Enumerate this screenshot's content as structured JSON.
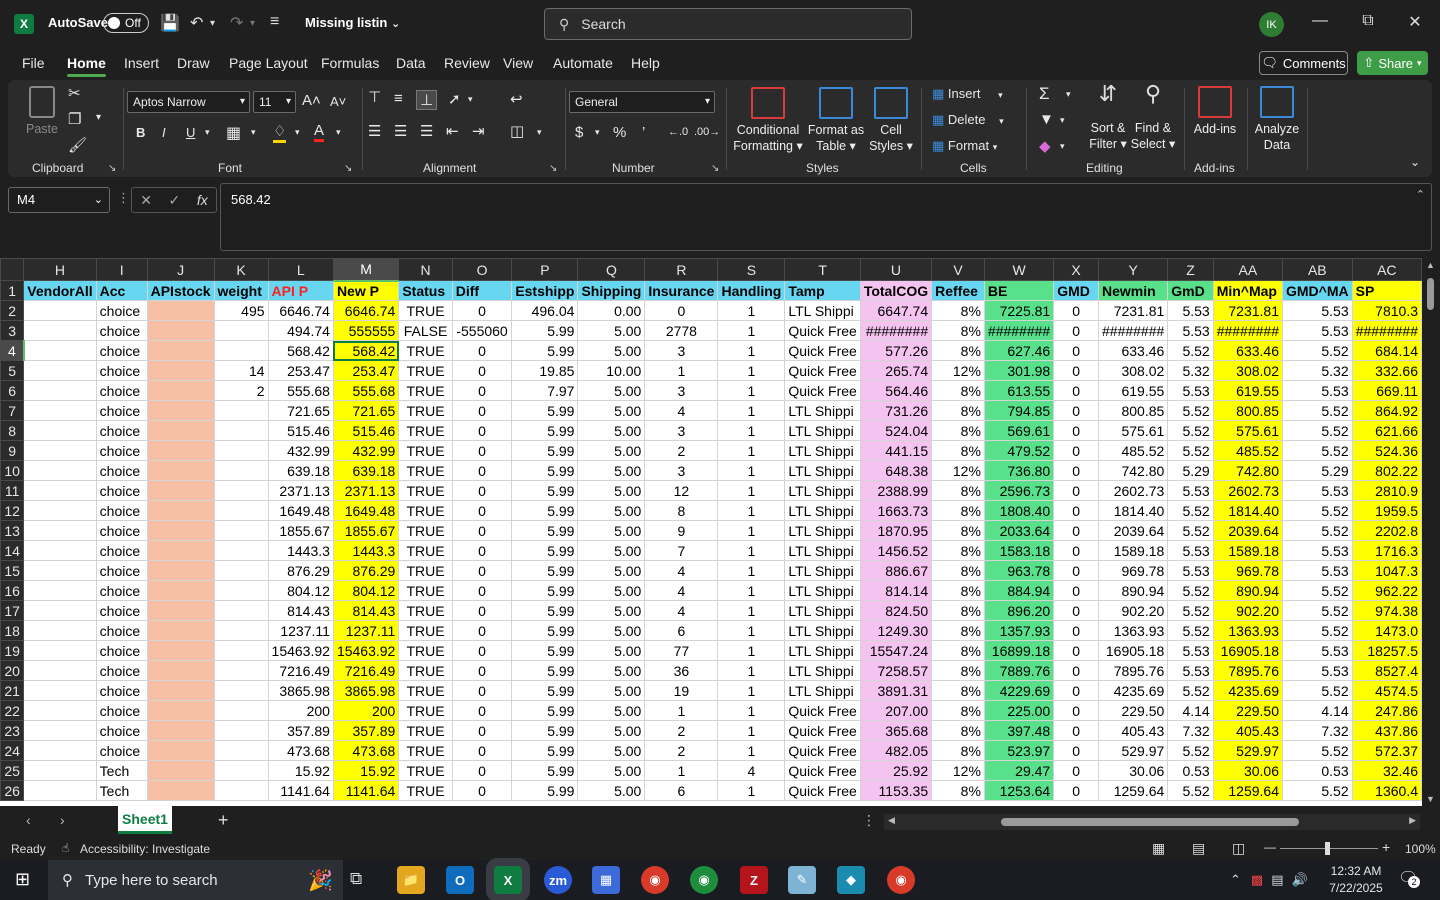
{
  "titlebar": {
    "app_icon": "excel-logo",
    "autosave_label": "AutoSave",
    "autosave_state": "Off",
    "doc_title": "Missing listin",
    "search_placeholder": "Search",
    "avatar_initials": "IK"
  },
  "menu": {
    "tabs": [
      "File",
      "Home",
      "Insert",
      "Draw",
      "Page Layout",
      "Formulas",
      "Data",
      "Review",
      "View",
      "Automate",
      "Help"
    ],
    "active": "Home",
    "comments_label": "Comments",
    "share_label": "Share"
  },
  "ribbon": {
    "clipboard": {
      "label": "Clipboard",
      "paste": "Paste"
    },
    "font": {
      "label": "Font",
      "family": "Aptos Narrow",
      "size": "11"
    },
    "alignment": {
      "label": "Alignment"
    },
    "number": {
      "label": "Number",
      "format": "General"
    },
    "styles": {
      "label": "Styles",
      "conditional_1": "Conditional",
      "conditional_2": "Formatting",
      "format_table_1": "Format as",
      "format_table_2": "Table",
      "cell_styles_1": "Cell",
      "cell_styles_2": "Styles"
    },
    "cells": {
      "label": "Cells",
      "insert": "Insert",
      "delete": "Delete",
      "format": "Format"
    },
    "editing": {
      "label": "Editing",
      "sort_1": "Sort &",
      "sort_2": "Filter",
      "find_1": "Find &",
      "find_2": "Select"
    },
    "addins": {
      "label": "Add-ins",
      "addins": "Add-ins",
      "analyze_1": "Analyze",
      "analyze_2": "Data"
    }
  },
  "formula_bar": {
    "name_box": "M4",
    "formula": "568.42"
  },
  "grid": {
    "columns": [
      "H",
      "I",
      "J",
      "K",
      "L",
      "M",
      "N",
      "O",
      "P",
      "Q",
      "R",
      "S",
      "T",
      "U",
      "V",
      "W",
      "X",
      "Y",
      "Z",
      "AA",
      "AB",
      "AC"
    ],
    "selected_column": "M",
    "selected_row": "4",
    "header_row": [
      "VendorAll",
      "Acc",
      "APIstock",
      "weight",
      "API P",
      "New P",
      "Status",
      "Diff",
      "Estshipp",
      "Shipping",
      "Insurance",
      "Handling",
      "Tamp",
      "TotalCOG",
      "Reffee",
      "BE",
      "GMD",
      "Newmin",
      "GmD",
      "Min^Map",
      "GMD^MA",
      "SP"
    ],
    "rows": [
      [
        "2",
        "",
        "choice",
        "",
        "495",
        "6646.74",
        "6646.74",
        "TRUE",
        "0",
        "496.04",
        "0.00",
        "0",
        "1",
        "LTL Shippi",
        "6647.74",
        "8%",
        "7225.81",
        "0",
        "7231.81",
        "5.53",
        "7231.81",
        "5.53",
        "7810.3"
      ],
      [
        "3",
        "",
        "choice",
        "",
        "",
        "494.74",
        "555555",
        "FALSE",
        "-555060",
        "5.99",
        "5.00",
        "2778",
        "1",
        "Quick Free",
        "########",
        "8%",
        "########",
        "0",
        "########",
        "5.53",
        "########",
        "5.53",
        "########"
      ],
      [
        "4",
        "",
        "choice",
        "",
        "",
        "568.42",
        "568.42",
        "TRUE",
        "0",
        "5.99",
        "5.00",
        "3",
        "1",
        "Quick Free",
        "577.26",
        "8%",
        "627.46",
        "0",
        "633.46",
        "5.52",
        "633.46",
        "5.52",
        "684.14"
      ],
      [
        "5",
        "",
        "choice",
        "",
        "14",
        "253.47",
        "253.47",
        "TRUE",
        "0",
        "19.85",
        "10.00",
        "1",
        "1",
        "Quick Free",
        "265.74",
        "12%",
        "301.98",
        "0",
        "308.02",
        "5.32",
        "308.02",
        "5.32",
        "332.66"
      ],
      [
        "6",
        "",
        "choice",
        "",
        "2",
        "555.68",
        "555.68",
        "TRUE",
        "0",
        "7.97",
        "5.00",
        "3",
        "1",
        "Quick Free",
        "564.46",
        "8%",
        "613.55",
        "0",
        "619.55",
        "5.53",
        "619.55",
        "5.53",
        "669.11"
      ],
      [
        "7",
        "",
        "choice",
        "",
        "",
        "721.65",
        "721.65",
        "TRUE",
        "0",
        "5.99",
        "5.00",
        "4",
        "1",
        "LTL Shippi",
        "731.26",
        "8%",
        "794.85",
        "0",
        "800.85",
        "5.52",
        "800.85",
        "5.52",
        "864.92"
      ],
      [
        "8",
        "",
        "choice",
        "",
        "",
        "515.46",
        "515.46",
        "TRUE",
        "0",
        "5.99",
        "5.00",
        "3",
        "1",
        "LTL Shippi",
        "524.04",
        "8%",
        "569.61",
        "0",
        "575.61",
        "5.52",
        "575.61",
        "5.52",
        "621.66"
      ],
      [
        "9",
        "",
        "choice",
        "",
        "",
        "432.99",
        "432.99",
        "TRUE",
        "0",
        "5.99",
        "5.00",
        "2",
        "1",
        "LTL Shippi",
        "441.15",
        "8%",
        "479.52",
        "0",
        "485.52",
        "5.52",
        "485.52",
        "5.52",
        "524.36"
      ],
      [
        "10",
        "",
        "choice",
        "",
        "",
        "639.18",
        "639.18",
        "TRUE",
        "0",
        "5.99",
        "5.00",
        "3",
        "1",
        "LTL Shippi",
        "648.38",
        "12%",
        "736.80",
        "0",
        "742.80",
        "5.29",
        "742.80",
        "5.29",
        "802.22"
      ],
      [
        "11",
        "",
        "choice",
        "",
        "",
        "2371.13",
        "2371.13",
        "TRUE",
        "0",
        "5.99",
        "5.00",
        "12",
        "1",
        "LTL Shippi",
        "2388.99",
        "8%",
        "2596.73",
        "0",
        "2602.73",
        "5.53",
        "2602.73",
        "5.53",
        "2810.9"
      ],
      [
        "12",
        "",
        "choice",
        "",
        "",
        "1649.48",
        "1649.48",
        "TRUE",
        "0",
        "5.99",
        "5.00",
        "8",
        "1",
        "LTL Shippi",
        "1663.73",
        "8%",
        "1808.40",
        "0",
        "1814.40",
        "5.52",
        "1814.40",
        "5.52",
        "1959.5"
      ],
      [
        "13",
        "",
        "choice",
        "",
        "",
        "1855.67",
        "1855.67",
        "TRUE",
        "0",
        "5.99",
        "5.00",
        "9",
        "1",
        "LTL Shippi",
        "1870.95",
        "8%",
        "2033.64",
        "0",
        "2039.64",
        "5.52",
        "2039.64",
        "5.52",
        "2202.8"
      ],
      [
        "14",
        "",
        "choice",
        "",
        "",
        "1443.3",
        "1443.3",
        "TRUE",
        "0",
        "5.99",
        "5.00",
        "7",
        "1",
        "LTL Shippi",
        "1456.52",
        "8%",
        "1583.18",
        "0",
        "1589.18",
        "5.53",
        "1589.18",
        "5.53",
        "1716.3"
      ],
      [
        "15",
        "",
        "choice",
        "",
        "",
        "876.29",
        "876.29",
        "TRUE",
        "0",
        "5.99",
        "5.00",
        "4",
        "1",
        "LTL Shippi",
        "886.67",
        "8%",
        "963.78",
        "0",
        "969.78",
        "5.53",
        "969.78",
        "5.53",
        "1047.3"
      ],
      [
        "16",
        "",
        "choice",
        "",
        "",
        "804.12",
        "804.12",
        "TRUE",
        "0",
        "5.99",
        "5.00",
        "4",
        "1",
        "LTL Shippi",
        "814.14",
        "8%",
        "884.94",
        "0",
        "890.94",
        "5.52",
        "890.94",
        "5.52",
        "962.22"
      ],
      [
        "17",
        "",
        "choice",
        "",
        "",
        "814.43",
        "814.43",
        "TRUE",
        "0",
        "5.99",
        "5.00",
        "4",
        "1",
        "LTL Shippi",
        "824.50",
        "8%",
        "896.20",
        "0",
        "902.20",
        "5.52",
        "902.20",
        "5.52",
        "974.38"
      ],
      [
        "18",
        "",
        "choice",
        "",
        "",
        "1237.11",
        "1237.11",
        "TRUE",
        "0",
        "5.99",
        "5.00",
        "6",
        "1",
        "LTL Shippi",
        "1249.30",
        "8%",
        "1357.93",
        "0",
        "1363.93",
        "5.52",
        "1363.93",
        "5.52",
        "1473.0"
      ],
      [
        "19",
        "",
        "choice",
        "",
        "",
        "15463.92",
        "15463.92",
        "TRUE",
        "0",
        "5.99",
        "5.00",
        "77",
        "1",
        "LTL Shippi",
        "15547.24",
        "8%",
        "16899.18",
        "0",
        "16905.18",
        "5.53",
        "16905.18",
        "5.53",
        "18257.5"
      ],
      [
        "20",
        "",
        "choice",
        "",
        "",
        "7216.49",
        "7216.49",
        "TRUE",
        "0",
        "5.99",
        "5.00",
        "36",
        "1",
        "LTL Shippi",
        "7258.57",
        "8%",
        "7889.76",
        "0",
        "7895.76",
        "5.53",
        "7895.76",
        "5.53",
        "8527.4"
      ],
      [
        "21",
        "",
        "choice",
        "",
        "",
        "3865.98",
        "3865.98",
        "TRUE",
        "0",
        "5.99",
        "5.00",
        "19",
        "1",
        "LTL Shippi",
        "3891.31",
        "8%",
        "4229.69",
        "0",
        "4235.69",
        "5.52",
        "4235.69",
        "5.52",
        "4574.5"
      ],
      [
        "22",
        "",
        "choice",
        "",
        "",
        "200",
        "200",
        "TRUE",
        "0",
        "5.99",
        "5.00",
        "1",
        "1",
        "Quick Free",
        "207.00",
        "8%",
        "225.00",
        "0",
        "229.50",
        "4.14",
        "229.50",
        "4.14",
        "247.86"
      ],
      [
        "23",
        "",
        "choice",
        "",
        "",
        "357.89",
        "357.89",
        "TRUE",
        "0",
        "5.99",
        "5.00",
        "2",
        "1",
        "Quick Free",
        "365.68",
        "8%",
        "397.48",
        "0",
        "405.43",
        "7.32",
        "405.43",
        "7.32",
        "437.86"
      ],
      [
        "24",
        "",
        "choice",
        "",
        "",
        "473.68",
        "473.68",
        "TRUE",
        "0",
        "5.99",
        "5.00",
        "2",
        "1",
        "Quick Free",
        "482.05",
        "8%",
        "523.97",
        "0",
        "529.97",
        "5.52",
        "529.97",
        "5.52",
        "572.37"
      ],
      [
        "25",
        "",
        "Tech",
        "",
        "",
        "15.92",
        "15.92",
        "TRUE",
        "0",
        "5.99",
        "5.00",
        "1",
        "4",
        "Quick Free",
        "25.92",
        "12%",
        "29.47",
        "0",
        "30.06",
        "0.53",
        "30.06",
        "0.53",
        "32.46"
      ],
      [
        "26",
        "",
        "Tech",
        "",
        "",
        "1141.64",
        "1141.64",
        "TRUE",
        "0",
        "5.99",
        "5.00",
        "6",
        "1",
        "Quick Free",
        "1153.35",
        "8%",
        "1253.64",
        "0",
        "1259.64",
        "5.52",
        "1259.64",
        "5.52",
        "1360.4"
      ]
    ]
  },
  "sheets": {
    "active": "Sheet1",
    "add_label": "+"
  },
  "statusbar": {
    "ready": "Ready",
    "accessibility": "Accessibility: Investigate",
    "zoom": "100%"
  },
  "taskbar": {
    "search_placeholder": "Type here to search",
    "time": "12:32 AM",
    "date": "7/22/2025",
    "notifications": "2"
  }
}
